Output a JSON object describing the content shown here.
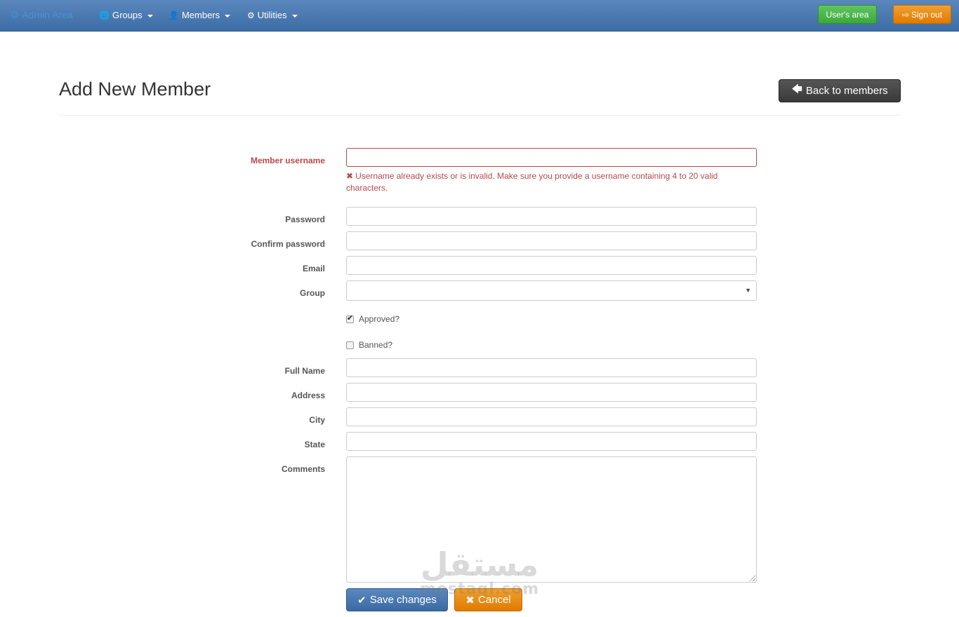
{
  "navbar": {
    "brand": "Admin Area",
    "items": [
      {
        "label": "Groups",
        "icon": "globe-icon"
      },
      {
        "label": "Members",
        "icon": "user-icon"
      },
      {
        "label": "Utilities",
        "icon": "cog-icon"
      }
    ],
    "users_area_label": "User's area",
    "signout_label": "Sign out"
  },
  "header": {
    "title": "Add New Member",
    "back_label": "Back to members"
  },
  "form": {
    "username_label": "Member username",
    "username_value": "",
    "username_error": "Username already exists or is invalid. Make sure you provide a username containing 4 to 20 valid characters.",
    "password_label": "Password",
    "confirm_password_label": "Confirm password",
    "email_label": "Email",
    "group_label": "Group",
    "group_value": "",
    "approved_label": "Approved?",
    "approved_checked": true,
    "banned_label": "Banned?",
    "banned_checked": false,
    "fullname_label": "Full Name",
    "address_label": "Address",
    "city_label": "City",
    "state_label": "State",
    "comments_label": "Comments",
    "save_label": "Save changes",
    "cancel_label": "Cancel"
  },
  "watermark": {
    "arabic": "مستقل",
    "latin": "mostaql.com"
  },
  "colors": {
    "navbar": "#4a7ab3",
    "error": "#b94a48",
    "success": "#3aa93a",
    "warning": "#e98a0c",
    "primary": "#3b6aa3"
  }
}
